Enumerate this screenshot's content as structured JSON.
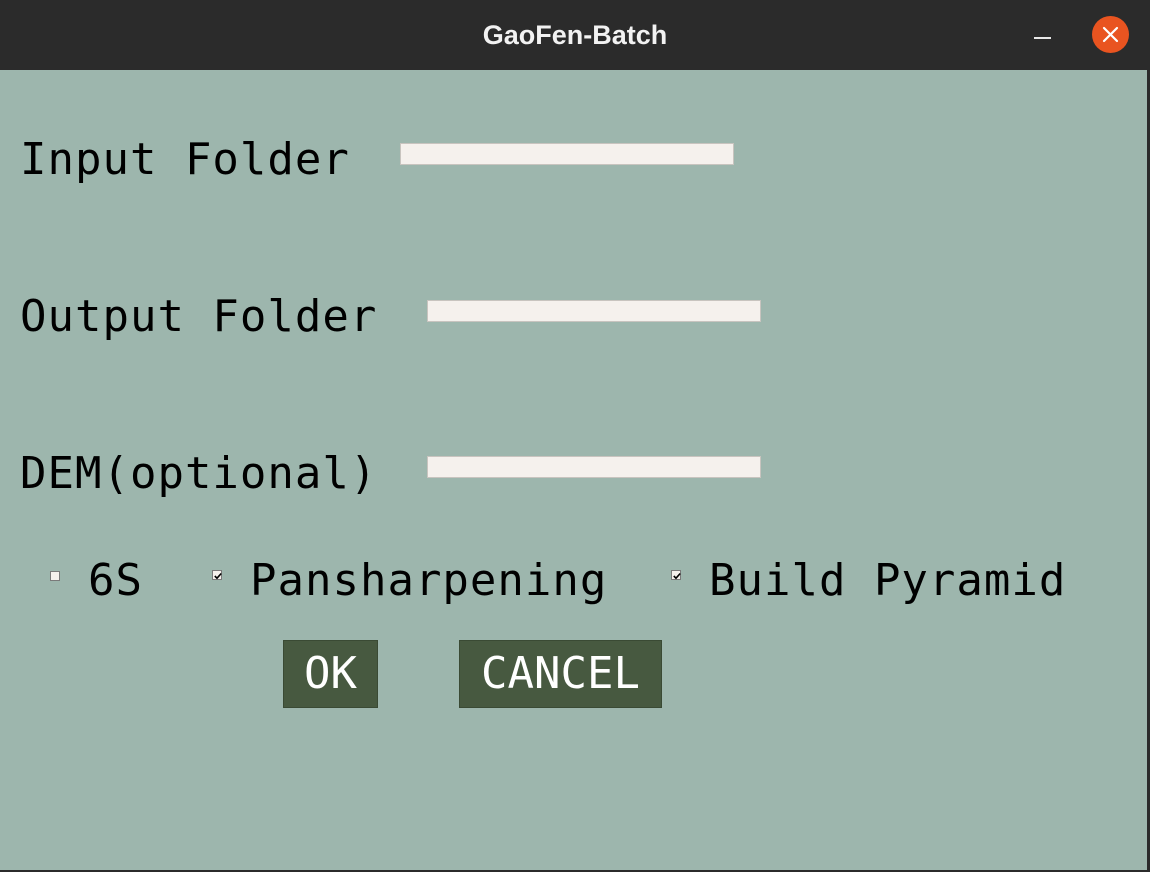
{
  "window": {
    "title": "GaoFen-Batch",
    "minimize_icon": "minimize-icon",
    "close_icon": "close-icon",
    "close_color": "#e95420"
  },
  "form": {
    "input_folder": {
      "label": "Input Folder",
      "value": ""
    },
    "output_folder": {
      "label": "Output Folder",
      "value": ""
    },
    "dem": {
      "label": "DEM(optional)",
      "value": ""
    }
  },
  "options": [
    {
      "label": "6S",
      "checked": false
    },
    {
      "label": "Pansharpening",
      "checked": true
    },
    {
      "label": "Build Pyramid",
      "checked": true
    }
  ],
  "buttons": {
    "ok_label": "OK",
    "cancel_label": "CANCEL"
  },
  "colors": {
    "background": "#9db6ad",
    "button": "#475940",
    "entry": "#f5f1ed"
  }
}
